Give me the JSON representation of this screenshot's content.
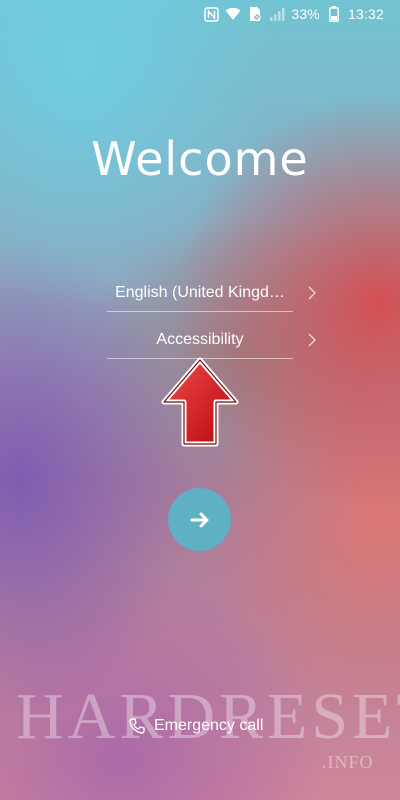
{
  "status_bar": {
    "icons": [
      "nfc-icon",
      "wifi-icon",
      "no-sim-icon",
      "signal-icon",
      "battery-icon"
    ],
    "battery_percent": "33%",
    "time": "13:32"
  },
  "welcome": {
    "title": "Welcome"
  },
  "options": {
    "language_label": "English (United Kingd…",
    "accessibility_label": "Accessibility"
  },
  "annotation": {
    "arrow_color": "#d0161c"
  },
  "next_button": {
    "icon": "arrow-right-icon",
    "color": "#5fb0c2"
  },
  "emergency": {
    "label": "Emergency call",
    "icon": "phone-icon"
  },
  "watermark": {
    "main": "HARDRESET",
    "sub": ".INFO"
  }
}
